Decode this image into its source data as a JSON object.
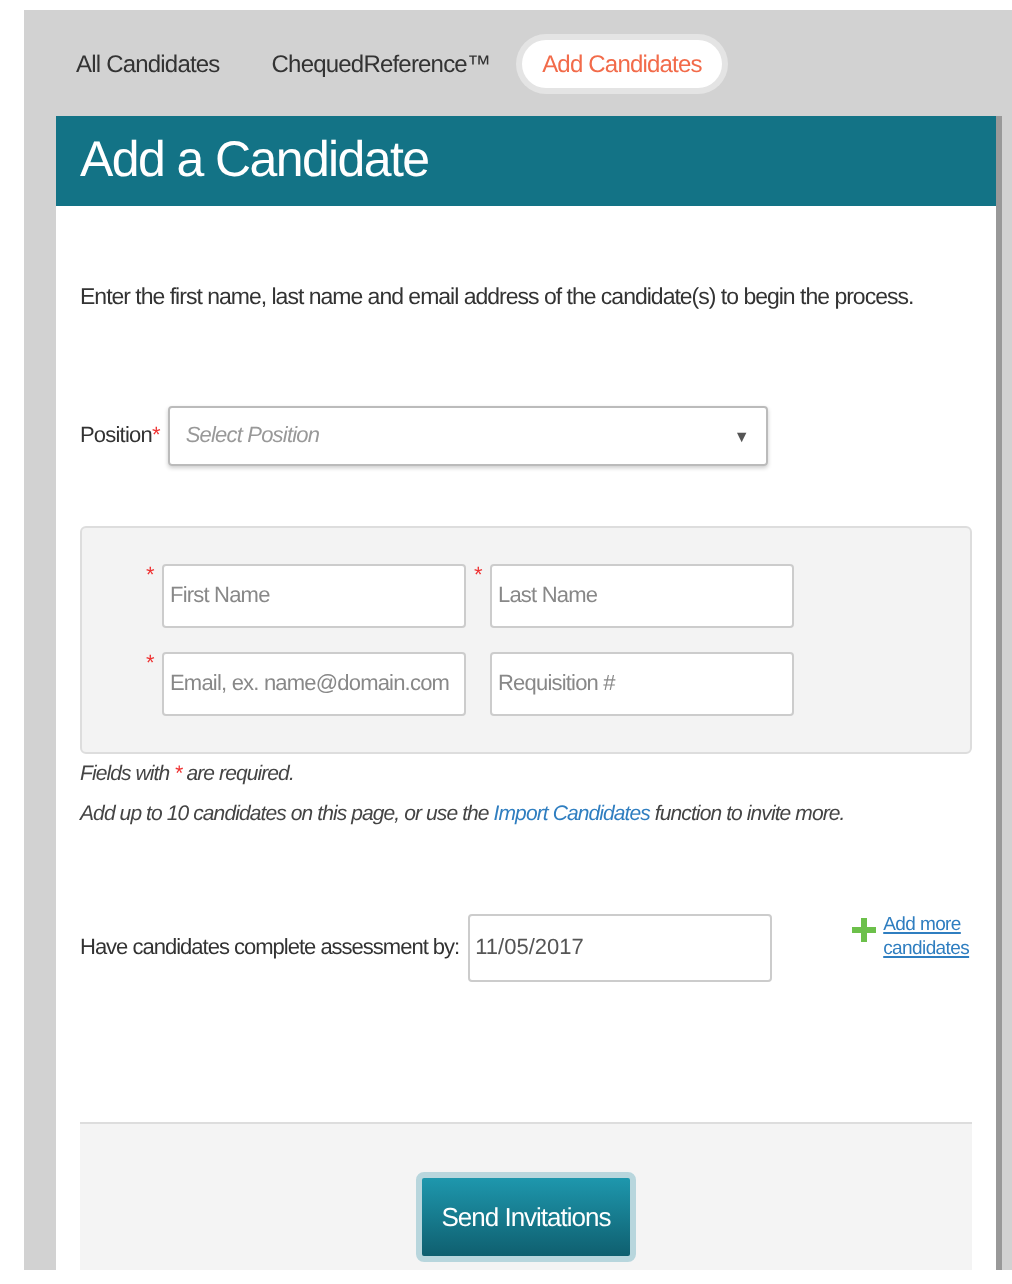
{
  "tabs": [
    {
      "label": "All Candidates",
      "selected": false
    },
    {
      "label": "ChequedReference™",
      "selected": false
    },
    {
      "label": "Add Candidates",
      "selected": true
    }
  ],
  "panel": {
    "title": "Add a Candidate",
    "intro": "Enter the first name, last name and email address of the candidate(s) to begin the process."
  },
  "required_mark": "*",
  "position": {
    "label": "Position",
    "required": true,
    "placeholder": "Select Position",
    "caret": "▼"
  },
  "candidate_fields": [
    {
      "placeholder": "First Name",
      "required": true
    },
    {
      "placeholder": "Last Name",
      "required": true
    },
    {
      "placeholder": "Email, ex. name@domain.com",
      "required": true
    },
    {
      "placeholder": "Requisition #",
      "required": false
    }
  ],
  "notes": {
    "required_before": "Fields with",
    "required_after": "are required.",
    "limit_before": "Add up to 10 candidates on this page, or use the",
    "limit_link": "Import Candidates",
    "limit_after": "function to invite more."
  },
  "deadline": {
    "label": "Have candidates complete assessment by:",
    "value": "11/05/2017"
  },
  "add_more": "Add more candidates",
  "submit": "Send Invitations"
}
